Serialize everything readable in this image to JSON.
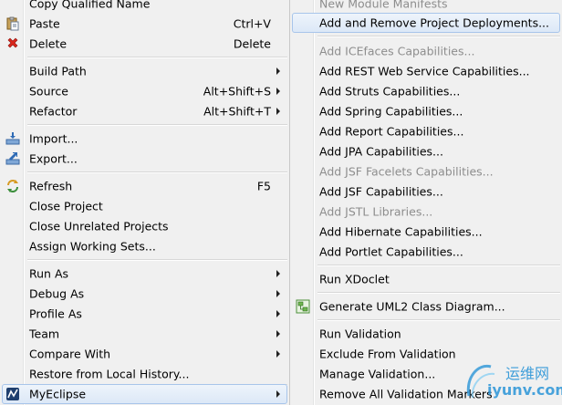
{
  "left_menu": {
    "items": [
      {
        "label": "Copy Qualified Name",
        "accel": ""
      },
      {
        "label": "Paste",
        "accel": "Ctrl+V",
        "icon": "paste-icon"
      },
      {
        "label": "Delete",
        "accel": "Delete",
        "icon": "delete-icon"
      },
      {
        "label": "Build Path",
        "accel": "",
        "submenu": true
      },
      {
        "label": "Source",
        "accel": "Alt+Shift+S",
        "submenu": true
      },
      {
        "label": "Refactor",
        "accel": "Alt+Shift+T",
        "submenu": true
      },
      {
        "label": "Import...",
        "accel": "",
        "icon": "import-icon"
      },
      {
        "label": "Export...",
        "accel": "",
        "icon": "export-icon"
      },
      {
        "label": "Refresh",
        "accel": "F5",
        "icon": "refresh-icon"
      },
      {
        "label": "Close Project",
        "accel": ""
      },
      {
        "label": "Close Unrelated Projects",
        "accel": ""
      },
      {
        "label": "Assign Working Sets...",
        "accel": ""
      },
      {
        "label": "Run As",
        "accel": "",
        "submenu": true
      },
      {
        "label": "Debug As",
        "accel": "",
        "submenu": true
      },
      {
        "label": "Profile As",
        "accel": "",
        "submenu": true
      },
      {
        "label": "Team",
        "accel": "",
        "submenu": true
      },
      {
        "label": "Compare With",
        "accel": "",
        "submenu": true
      },
      {
        "label": "Restore from Local History...",
        "accel": ""
      },
      {
        "label": "MyEclipse",
        "accel": "",
        "submenu": true,
        "icon": "myeclipse-icon",
        "highlighted": true
      }
    ]
  },
  "right_menu": {
    "items": [
      {
        "label": "New Module Manifests",
        "disabled": true
      },
      {
        "label": "Add and Remove Project Deployments...",
        "highlighted": true
      },
      {
        "label": "Add ICEfaces Capabilities...",
        "disabled": true
      },
      {
        "label": "Add REST Web Service Capabilities..."
      },
      {
        "label": "Add Struts Capabilities..."
      },
      {
        "label": "Add Spring Capabilities..."
      },
      {
        "label": "Add Report Capabilities..."
      },
      {
        "label": "Add JPA Capabilities..."
      },
      {
        "label": "Add JSF Facelets Capabilities...",
        "disabled": true
      },
      {
        "label": "Add JSF Capabilities..."
      },
      {
        "label": "Add JSTL Libraries...",
        "disabled": true
      },
      {
        "label": "Add Hibernate Capabilities..."
      },
      {
        "label": "Add Portlet Capabilities..."
      },
      {
        "label": "Run XDoclet"
      },
      {
        "label": "Generate UML2 Class Diagram...",
        "icon": "uml-diagram-icon"
      },
      {
        "label": "Run Validation"
      },
      {
        "label": "Exclude From Validation"
      },
      {
        "label": "Manage Validation..."
      },
      {
        "label": "Remove All Validation Markers"
      }
    ]
  },
  "watermark": {
    "brand_cn": "运维网",
    "domain": "iyunv.com"
  },
  "colors": {
    "menu_bg": "#f0f0f0",
    "highlight_border": "#a8c5ea",
    "disabled_text": "#8d8d8d",
    "watermark_blue": "#1e8fd6"
  }
}
